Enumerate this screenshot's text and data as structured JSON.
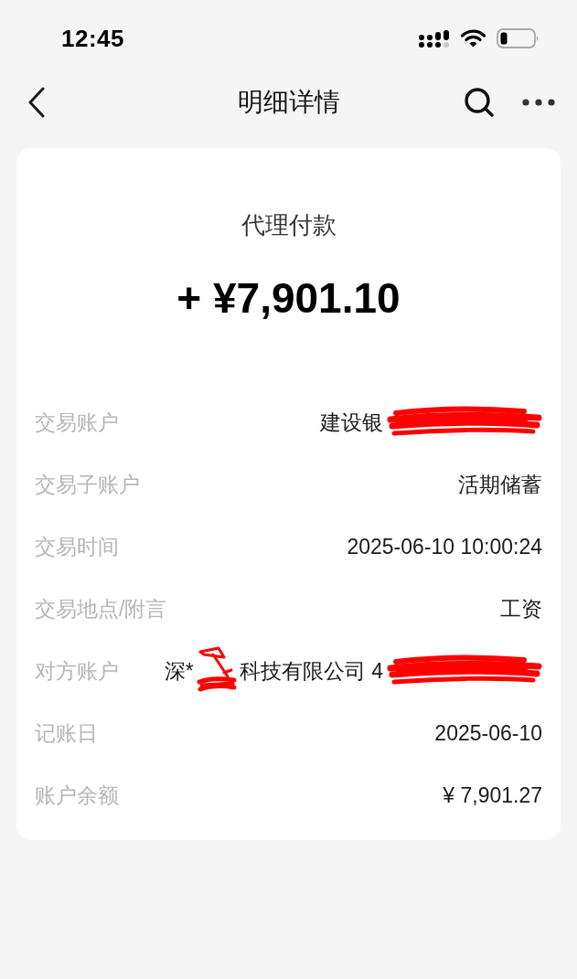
{
  "status_bar": {
    "time": "12:45"
  },
  "nav": {
    "title": "明细详情"
  },
  "summary": {
    "type": "代理付款",
    "amount": "+ ¥7,901.10"
  },
  "details": [
    {
      "label": "交易账户",
      "value": [
        {
          "kind": "text",
          "text": "建设银"
        },
        {
          "kind": "redaction"
        }
      ]
    },
    {
      "label": "交易子账户",
      "value": [
        {
          "kind": "text",
          "text": "活期储蓄"
        }
      ]
    },
    {
      "label": "交易时间",
      "value": [
        {
          "kind": "text",
          "text": "2025-06-10 10:00:24"
        }
      ]
    },
    {
      "label": "交易地点/附言",
      "value": [
        {
          "kind": "text",
          "text": "工资"
        }
      ]
    },
    {
      "label": "对方账户",
      "value": [
        {
          "kind": "text",
          "text": "深*"
        },
        {
          "kind": "redaction"
        },
        {
          "kind": "text",
          "text": "科技有限公司 4"
        },
        {
          "kind": "redaction"
        }
      ]
    },
    {
      "label": "记账日",
      "value": [
        {
          "kind": "text",
          "text": "2025-06-10"
        }
      ]
    },
    {
      "label": "账户余额",
      "value": [
        {
          "kind": "text",
          "text": "¥ 7,901.27"
        }
      ]
    }
  ]
}
